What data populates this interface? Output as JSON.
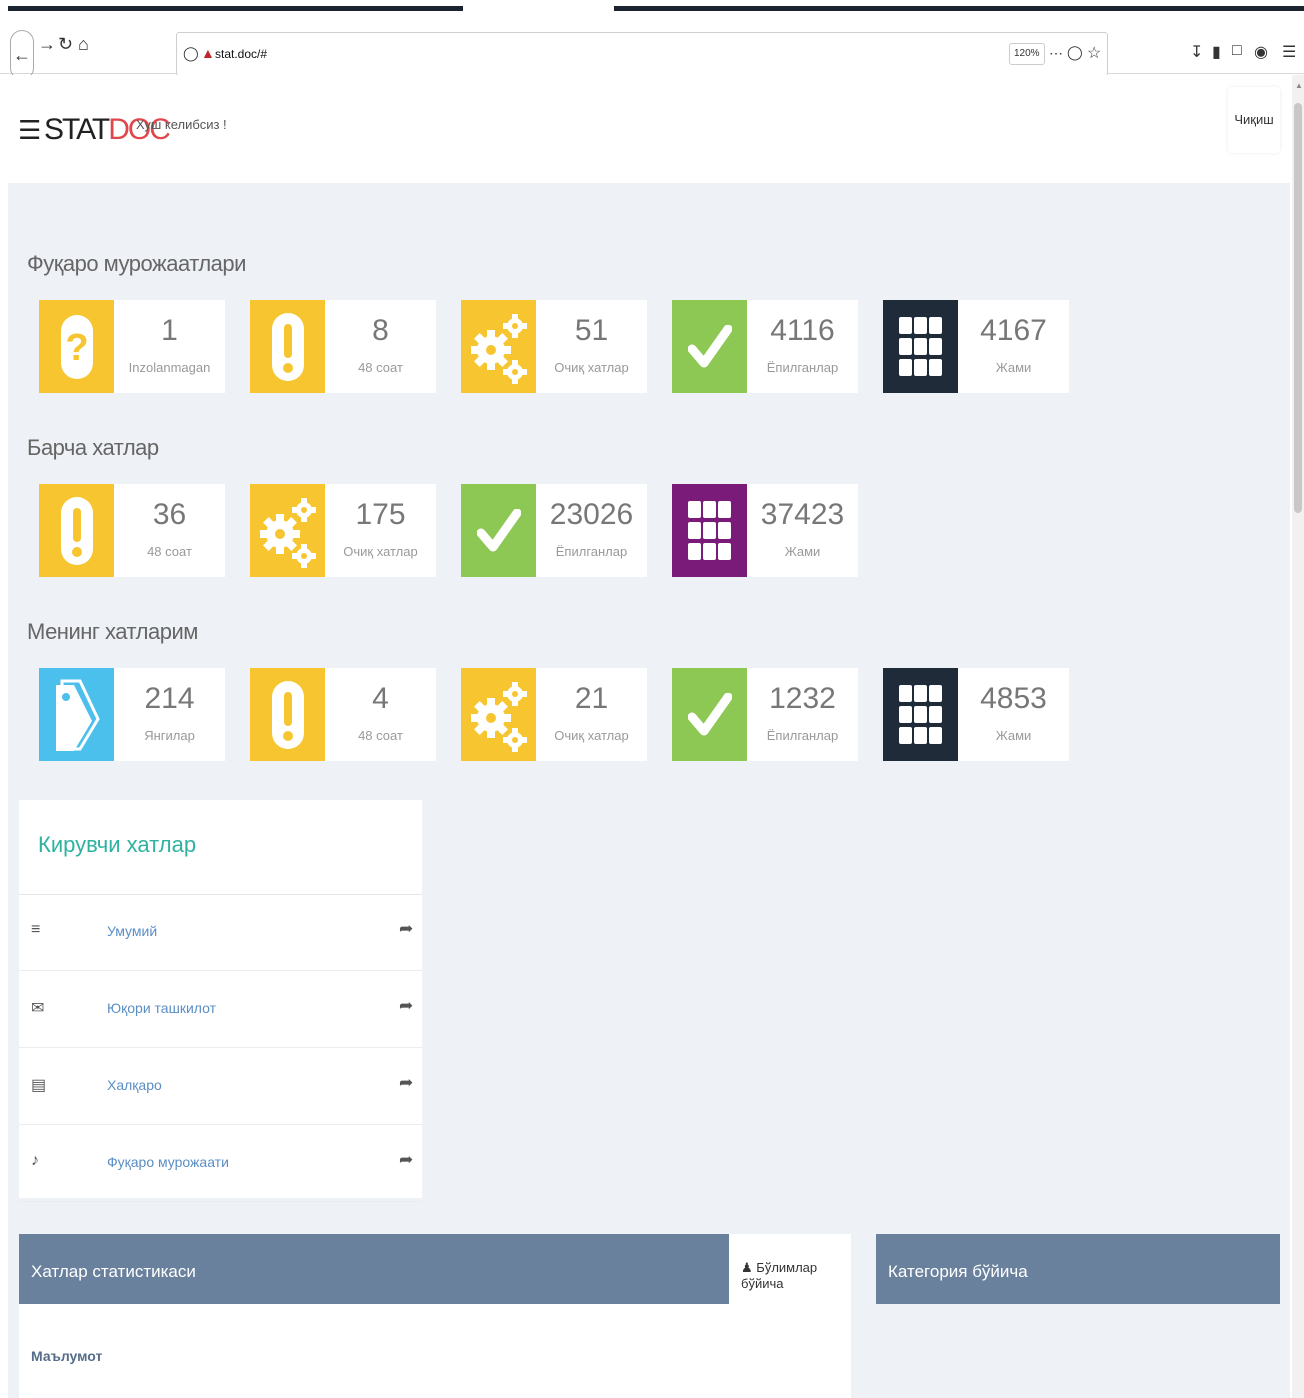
{
  "browser": {
    "url": "stat.doc/#",
    "zoom": "120%",
    "more_glyph": "⋯"
  },
  "header": {
    "logo_main": "STAT",
    "logo_accent": "DOC",
    "welcome": "Хуш келибсиз !",
    "exit_label": "Чиқиш",
    "accent_color": "#e0474c"
  },
  "sections": [
    {
      "title": "Фуқаро мурожаатлари",
      "cards": [
        {
          "icon": "question-icon",
          "color": "#f6c52f",
          "value": "1",
          "label": "Inzolanmagan"
        },
        {
          "icon": "exclamation-icon",
          "color": "#f6c52f",
          "value": "8",
          "label": "48 соат"
        },
        {
          "icon": "gears-icon",
          "color": "#f6c52f",
          "value": "51",
          "label": "Очиқ хатлар"
        },
        {
          "icon": "check-icon",
          "color": "#8cc853",
          "value": "4116",
          "label": "Ёпилганлар"
        },
        {
          "icon": "grid-icon",
          "color": "#1f2b38",
          "value": "4167",
          "label": "Жами"
        }
      ]
    },
    {
      "title": "Барча хатлар",
      "cards": [
        {
          "icon": "exclamation-icon",
          "color": "#f6c52f",
          "value": "36",
          "label": "48 соат"
        },
        {
          "icon": "gears-icon",
          "color": "#f6c52f",
          "value": "175",
          "label": "Очиқ хатлар"
        },
        {
          "icon": "check-icon",
          "color": "#8cc853",
          "value": "23026",
          "label": "Ёпилганлар"
        },
        {
          "icon": "grid-icon",
          "color": "#7a1a79",
          "value": "37423",
          "label": "Жами"
        }
      ]
    },
    {
      "title": "Менинг хатларим",
      "cards": [
        {
          "icon": "tags-icon",
          "color": "#4cc0ec",
          "value": "214",
          "label": "Янгилар"
        },
        {
          "icon": "exclamation-icon",
          "color": "#f6c52f",
          "value": "4",
          "label": "48 соат"
        },
        {
          "icon": "gears-icon",
          "color": "#f6c52f",
          "value": "21",
          "label": "Очиқ хатлар"
        },
        {
          "icon": "check-icon",
          "color": "#8cc853",
          "value": "1232",
          "label": "Ёпилганлар"
        },
        {
          "icon": "grid-icon",
          "color": "#1f2b38",
          "value": "4853",
          "label": "Жами"
        }
      ]
    }
  ],
  "incoming": {
    "title": "Кирувчи хатлар",
    "items": [
      {
        "icon": "list-icon",
        "label": "Умумий"
      },
      {
        "icon": "envelope-icon",
        "label": "Юқори ташкилот"
      },
      {
        "icon": "calendar-icon",
        "label": "Халқаро"
      },
      {
        "icon": "bell-icon",
        "label": "Фуқаро мурожаати"
      }
    ]
  },
  "stats_panel": {
    "title": "Хатлар статистикаси",
    "tab_label": "Бўлимлар бўйича",
    "info_label": "Маълумот"
  },
  "category_panel": {
    "title": "Категория бўйича"
  }
}
